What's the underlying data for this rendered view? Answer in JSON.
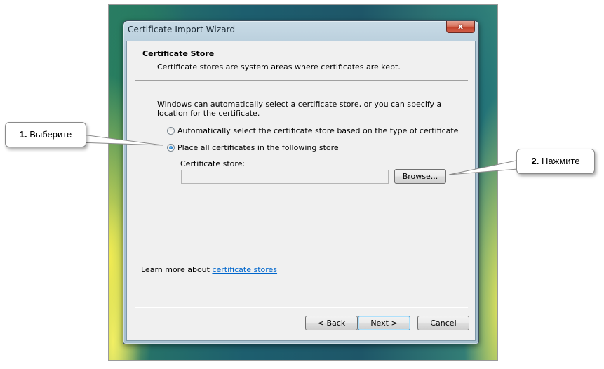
{
  "window": {
    "title": "Certificate Import Wizard",
    "close_label": "x"
  },
  "header": {
    "title": "Certificate Store",
    "subtitle": "Certificate stores are system areas where certificates are kept."
  },
  "body": {
    "intro": "Windows can automatically select a certificate store, or you can specify a location for the certificate.",
    "radio_auto_label": "Automatically select the certificate store based on the type of certificate",
    "radio_place_label": "Place all certificates in the following store",
    "selected_option": "place",
    "store_label": "Certificate store:",
    "store_value": "",
    "browse_label": "Browse..."
  },
  "learn_more": {
    "prefix": "Learn more about ",
    "link_text": "certificate stores"
  },
  "footer": {
    "back_label": "< Back",
    "next_label": "Next >",
    "cancel_label": "Cancel"
  },
  "callouts": {
    "first": {
      "number": "1.",
      "text": " Выберите"
    },
    "second": {
      "number": "2.",
      "text": " Нажмите"
    }
  },
  "colors": {
    "link": "#0066cc",
    "close_button": "#c2422b",
    "default_button_border": "#3c7fb1"
  }
}
